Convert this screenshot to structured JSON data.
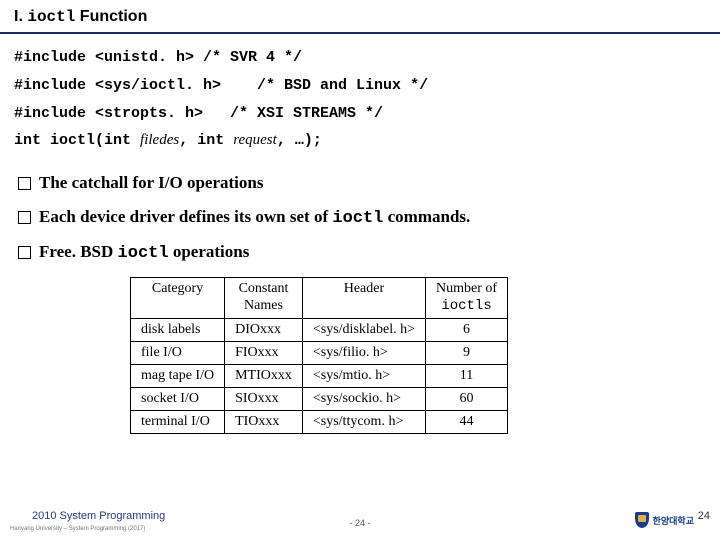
{
  "title": {
    "prefix": "I. ",
    "mono": "ioctl",
    "suffix": " Function"
  },
  "code": {
    "l1a": "#include <unistd. h> /* SVR 4 */",
    "l2a": "#include <sys/ioctl. h>    /* BSD and Linux */",
    "l3a": "#include <stropts. h>   /* XSI STREAMS */",
    "l4a": "int ioctl(int ",
    "l4b": "filedes",
    "l4c": ", int ",
    "l4d": "request",
    "l4e": ", …);"
  },
  "bullets": {
    "b1": "The catchall for I/O operations",
    "b2a": "Each device driver defines its own set of ",
    "b2m": "ioctl",
    "b2b": " commands.",
    "b3a": "Free. BSD ",
    "b3m": "ioctl",
    "b3b": " operations"
  },
  "table": {
    "headers": {
      "c1": "Category",
      "c2a": "Constant",
      "c2b": "Names",
      "c3": "Header",
      "c4a": "Number of",
      "c4m": "ioctls"
    },
    "rows": [
      {
        "cat": "disk labels",
        "con": "DIOxxx",
        "hdr": "<sys/disklabel. h>",
        "n": "6"
      },
      {
        "cat": "file I/O",
        "con": "FIOxxx",
        "hdr": "<sys/filio. h>",
        "n": "9"
      },
      {
        "cat": "mag tape I/O",
        "con": "MTIOxxx",
        "hdr": "<sys/mtio. h>",
        "n": "11"
      },
      {
        "cat": "socket I/O",
        "con": "SIOxxx",
        "hdr": "<sys/sockio. h>",
        "n": "60"
      },
      {
        "cat": "terminal I/O",
        "con": "TIOxxx",
        "hdr": "<sys/ttycom. h>",
        "n": "44"
      }
    ]
  },
  "footer": {
    "line1": "2010 System Programming",
    "line2": "Hanyang University – System Programming (2017)",
    "center": "- 24 -",
    "page": "24",
    "uni": "한양대학교"
  }
}
